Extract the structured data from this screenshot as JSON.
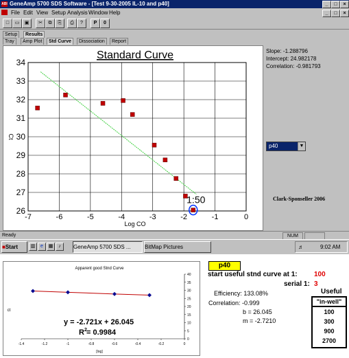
{
  "window": {
    "title": "GeneAmp 5700 SDS Software - [Test 9-30-2005 IL-10 and p40]",
    "app_icon": "ABI",
    "controls": [
      "_",
      "□",
      "×"
    ],
    "doc_controls": [
      "_",
      "□",
      "×"
    ]
  },
  "menu": [
    "File",
    "Edit",
    "View",
    "Setup",
    "Analysis",
    "Window",
    "Help"
  ],
  "toolbar": {
    "p_label": "P",
    "zero_label": "0"
  },
  "tabs_top": [
    "Setup",
    "Results"
  ],
  "tabs_sub": [
    "Tray",
    "Amp Plot",
    "Std Curve",
    "Dissociation",
    "Report"
  ],
  "stats": {
    "slope": "Slope: -1.288796",
    "intercept": "Intercept: 24.982178",
    "correlation": "Correlation: -0.981793"
  },
  "dropdown_value": "p40",
  "credit": "Clark-Sponseller 2006",
  "chart_data": [
    {
      "type": "scatter",
      "title": "Standard Curve",
      "xlabel": "Log CO",
      "ylabel": "Ct",
      "xlim": [
        -7,
        0
      ],
      "ylim": [
        26,
        34
      ],
      "xticks": [
        "-7",
        "-6",
        "-5",
        "-4",
        "-3",
        "-2",
        "-1",
        "0"
      ],
      "yticks": [
        "26",
        "27",
        "28",
        "29",
        "30",
        "31",
        "32",
        "33",
        "34"
      ],
      "grid": true,
      "points": [
        {
          "x": -6.7,
          "y": 31.55
        },
        {
          "x": -5.8,
          "y": 32.25
        },
        {
          "x": -4.6,
          "y": 31.8
        },
        {
          "x": -3.95,
          "y": 31.95
        },
        {
          "x": -3.65,
          "y": 31.2
        },
        {
          "x": -2.95,
          "y": 29.55
        },
        {
          "x": -2.6,
          "y": 28.75
        },
        {
          "x": -2.25,
          "y": 27.75
        },
        {
          "x": -1.95,
          "y": 26.8
        },
        {
          "x": -1.7,
          "y": 26.05
        }
      ],
      "trendline": [
        {
          "x": -6.6,
          "y": 33.5
        },
        {
          "x": -1.6,
          "y": 26.9
        }
      ],
      "annotation": "1:50",
      "colors": {
        "point": "#c00000",
        "trend": "#40d040",
        "circle": "#0030ff"
      }
    },
    {
      "type": "line",
      "title": "Apparent good Stnd Curve",
      "xlabel": "[log]",
      "ylabel": "ct",
      "xlim": [
        -1.4,
        0
      ],
      "ylim": [
        0,
        40
      ],
      "xticks": [
        "-1.4",
        "-1.2",
        "-1",
        "-0.8",
        "-0.6",
        "-0.4",
        "-0.2",
        "0"
      ],
      "yticks": [
        "0",
        "5",
        "10",
        "15",
        "20",
        "25",
        "30",
        "35",
        "40"
      ],
      "points": [
        {
          "x": -1.3,
          "y": 29.6
        },
        {
          "x": -1.0,
          "y": 28.8
        },
        {
          "x": -0.6,
          "y": 27.7
        },
        {
          "x": -0.3,
          "y": 27.0
        }
      ],
      "equation": "y = -2.721x + 26.045",
      "r2": "R  = 0.9984",
      "colors": {
        "line": "#c00000",
        "point": "#0a0a90"
      }
    }
  ],
  "status": {
    "left": "Ready",
    "num": "NUM"
  },
  "taskbar": {
    "start": "Start",
    "task1": "GeneAmp 5700 SDS ...",
    "task2": "BitMap Pictures",
    "clock": "9:02 AM"
  },
  "notes": {
    "p40_label": "p40",
    "start_line": "start useful stnd curve at 1:",
    "start_value": "100",
    "serial_label": "serial 1:",
    "serial_value": "3",
    "useful_title": "Useful",
    "efficiency": "Efficiency: 133.08%",
    "correlation": "Correlation: -0.999",
    "b": "b = 26.045",
    "m": "m = -2.7210",
    "in_well_header": "\"in-well\"",
    "in_well_values": [
      "100",
      "300",
      "900",
      "2700"
    ]
  }
}
